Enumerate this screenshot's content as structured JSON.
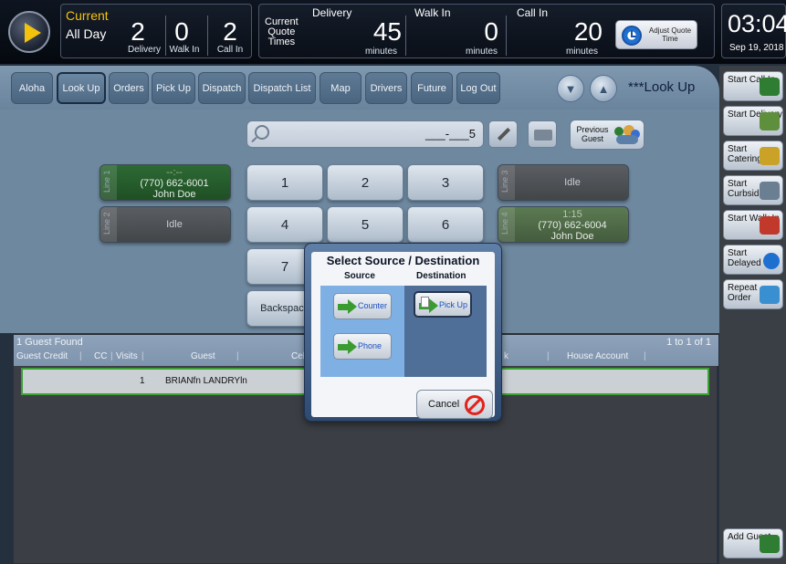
{
  "topbar": {
    "current_label": "Current",
    "period_label": "All Day",
    "counts": [
      {
        "value": "2",
        "caption": "Delivery"
      },
      {
        "value": "0",
        "caption": "Walk In"
      },
      {
        "value": "2",
        "caption": "Call In"
      }
    ],
    "quote_times_label": [
      "Current",
      "Quote",
      "Times"
    ],
    "quotes": [
      {
        "caption": "Delivery",
        "value": "45",
        "unit": "minutes"
      },
      {
        "caption": "Walk In",
        "value": "0",
        "unit": "minutes"
      },
      {
        "caption": "Call In",
        "value": "20",
        "unit": "minutes"
      }
    ],
    "adjust_quote_time_label": "Adjust Quote Time",
    "time": "03:04",
    "date": "Sep 19, 2018"
  },
  "nav": {
    "items": [
      "Aloha",
      "Look Up",
      "Orders",
      "Pick Up",
      "Dispatch",
      "Dispatch List",
      "Map",
      "Drivers",
      "Future",
      "Log Out"
    ],
    "active": "Look Up",
    "title": "***Look Up",
    "scroll_down_icon": "chevron-down-icon",
    "scroll_up_icon": "chevron-up-icon"
  },
  "search": {
    "value": "___-___5",
    "previous_guest_label": "Previous Guest"
  },
  "lines": [
    {
      "tab": "Line 1",
      "time": "--:--",
      "phone": "(770) 662-6001",
      "name": "John Doe",
      "state": "green"
    },
    {
      "tab": "Line 2",
      "text": "Idle",
      "state": "gray"
    },
    {
      "tab": "Line 3",
      "text": "Idle",
      "state": "gray"
    },
    {
      "tab": "Line 4",
      "time": "1:15",
      "phone": "(770) 662-6004",
      "name": "John Doe",
      "state": "olive"
    }
  ],
  "keypad": [
    "1",
    "2",
    "3",
    "4",
    "5",
    "6",
    "7",
    "Backspace"
  ],
  "guest_list": {
    "found": "1 Guest Found",
    "range": "1 to 1 of 1",
    "columns": [
      "Guest Credit",
      "CC",
      "Visits",
      "Guest",
      "Cel",
      "k",
      "House Account"
    ],
    "rows": [
      {
        "visits": "1",
        "guest": "BRIANfn LANDRYln"
      }
    ]
  },
  "sidebar": [
    {
      "label": "Start Call In",
      "icon": "phone-plus-icon",
      "color": "#2e7d32"
    },
    {
      "label": "Start Delivery",
      "icon": "delivery-truck-icon",
      "color": "#5e8f3c"
    },
    {
      "label": "Start Catering",
      "icon": "catering-icon",
      "color": "#c9a227"
    },
    {
      "label": "Start Curbside",
      "icon": "curbside-car-icon",
      "color": "#6a7f92"
    },
    {
      "label": "Start Walk In",
      "icon": "walk-in-icon",
      "color": "#c0392b"
    },
    {
      "label": "Start Delayed",
      "icon": "clock-icon",
      "color": "#1f6fd1"
    },
    {
      "label": "Repeat Order",
      "icon": "repeat-order-icon",
      "color": "#3a8fd1"
    },
    {
      "label": "Add Guest",
      "icon": "add-guest-icon",
      "color": "#2e7d32"
    }
  ],
  "modal": {
    "title": "Select Source / Destination",
    "source_label": "Source",
    "destination_label": "Destination",
    "sources": [
      "Counter",
      "Phone"
    ],
    "destinations": [
      "Pick Up"
    ],
    "cancel_label": "Cancel"
  }
}
